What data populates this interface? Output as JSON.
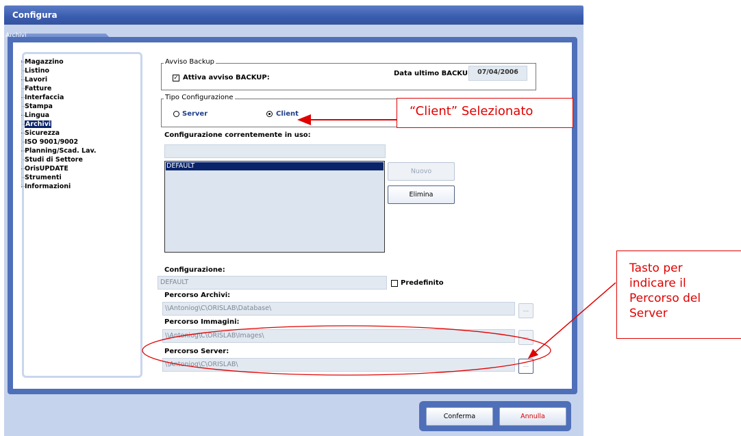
{
  "window": {
    "title": "Configura"
  },
  "tabs": [
    {
      "label": "Archivi"
    }
  ],
  "sidebar": {
    "items": [
      {
        "label": "Magazzino"
      },
      {
        "label": "Listino"
      },
      {
        "label": "Lavori"
      },
      {
        "label": "Fatture"
      },
      {
        "label": "Interfaccia"
      },
      {
        "label": "Stampa"
      },
      {
        "label": "Lingua"
      },
      {
        "label": "Archivi"
      },
      {
        "label": "Sicurezza"
      },
      {
        "label": "ISO 9001/9002"
      },
      {
        "label": "Planning/Scad. Lav."
      },
      {
        "label": "Studi di Settore"
      },
      {
        "label": "OrisUPDATE"
      },
      {
        "label": "Strumenti"
      },
      {
        "label": "Informazioni"
      }
    ],
    "selected": "Archivi"
  },
  "backup": {
    "group_title": "Avviso Backup",
    "checkbox_label": "Attiva avviso BACKUP:",
    "checked": true,
    "last_backup_label": "Data ultimo BACKUP:",
    "last_backup_value": "07/04/2006"
  },
  "config_type": {
    "group_title": "Tipo Configurazione",
    "options": [
      {
        "label": "Server",
        "selected": false
      },
      {
        "label": "Client",
        "selected": true
      }
    ]
  },
  "current_config": {
    "label": "Configurazione correntemente in uso:",
    "value": ""
  },
  "config_list": {
    "items": [
      "DEFAULT"
    ],
    "selected": "DEFAULT"
  },
  "buttons": {
    "new": "Nuovo",
    "delete": "Elimina",
    "browse": "...",
    "confirm": "Conferma",
    "cancel": "Annulla"
  },
  "config_name": {
    "label": "Configurazione:",
    "value": "DEFAULT",
    "default_label": "Predefinito",
    "default_checked": false
  },
  "archive_path": {
    "label": "Percorso Archivi:",
    "value": "\\\\Antoniog\\C\\ORISLAB\\Database\\"
  },
  "images_path": {
    "label": "Percorso Immagini:",
    "value": "\\\\Antoniog\\C\\ORISLAB\\Images\\"
  },
  "server_path": {
    "label": "Percorso Server:",
    "value": "\\\\Antoniog\\C\\ORISLAB\\"
  },
  "annotations": {
    "client_note": "“Client” Selezionato",
    "server_button_note": [
      "Tasto per",
      "indicare il",
      "Percorso del",
      "Server"
    ]
  },
  "colors": {
    "accent": "#4f6fb8",
    "annotation": "#e00000",
    "selection": "#0a246a",
    "cancel_text": "#e00000"
  }
}
